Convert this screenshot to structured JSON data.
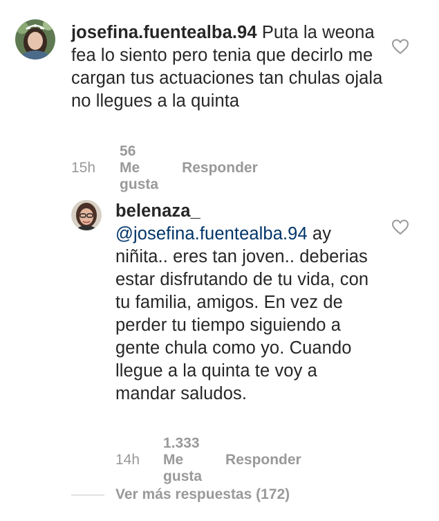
{
  "comments": [
    {
      "username": "josefina.fuentealba.94",
      "text": "Puta la weona fea lo siento pero tenia que decirlo me cargan tus actuaciones tan chulas ojala no llegues a la quinta",
      "time": "15h",
      "likes": "56 Me gusta",
      "reply": "Responder",
      "avatar_icon": "profile-photo"
    },
    {
      "username": "belenaza_",
      "mention": "@josefina.fuentealba.94",
      "text": "ay niñita.. eres tan joven.. deberias estar disfrutando de tu vida, con tu familia, amigos. En vez de perder tu tiempo siguiendo a gente chula como yo. Cuando llegue a la quinta te voy a mandar saludos.",
      "time": "14h",
      "likes": "1.333 Me gusta",
      "reply": "Responder",
      "avatar_icon": "profile-photo"
    }
  ],
  "more_replies": "Ver más respuestas (172)",
  "colors": {
    "text": "#262626",
    "meta": "#999999",
    "mention": "#003569",
    "heart": "#999999"
  },
  "icons": {
    "like": "heart-icon"
  }
}
